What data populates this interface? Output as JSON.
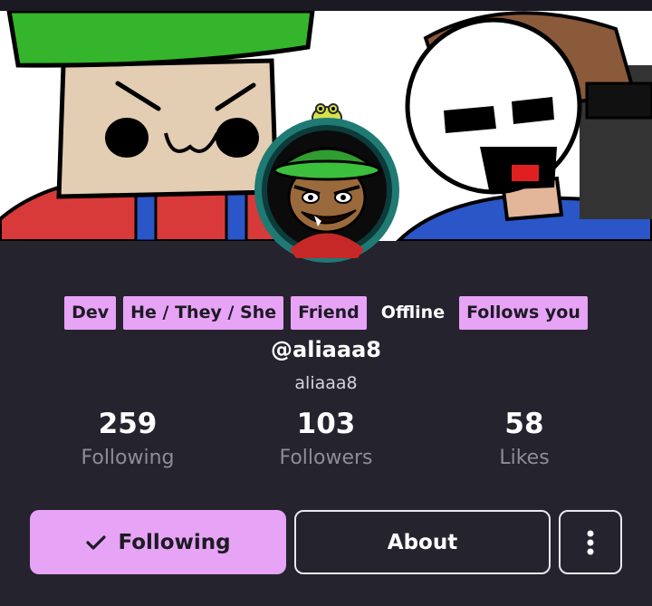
{
  "profile": {
    "badges": [
      "Dev",
      "He / They / She",
      "Friend",
      "Offline",
      "Follows you"
    ],
    "handle": "@aliaaa8",
    "username": "aliaaa8"
  },
  "stats": {
    "following": {
      "value": "259",
      "label": "Following"
    },
    "followers": {
      "value": "103",
      "label": "Followers"
    },
    "likes": {
      "value": "58",
      "label": "Likes"
    }
  },
  "actions": {
    "follow_label": "Following",
    "about_label": "About"
  },
  "icons": {
    "check": "check-icon",
    "more": "more-vertical-icon"
  },
  "colors": {
    "accent": "#e7a3f5",
    "background": "#25232e",
    "muted_text": "#8e8c97"
  }
}
